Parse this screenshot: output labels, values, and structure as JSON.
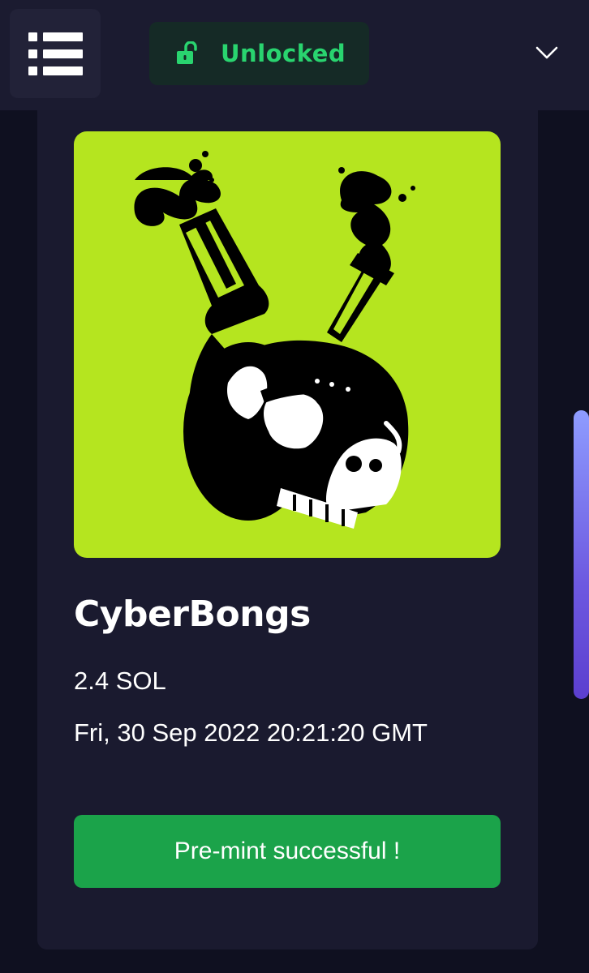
{
  "header": {
    "menu_icon": "list-icon",
    "unlock_label": "Unlocked",
    "unlock_icon": "unlocked-padlock-icon",
    "dropdown_icon": "chevron-down-icon"
  },
  "nft": {
    "name": "CyberBongs",
    "price": "2.4 SOL",
    "date": "Fri, 30 Sep 2022 20:21:20 GMT",
    "image_subject": "skull-bong-illustration",
    "status_label": "Pre-mint successful !"
  },
  "colors": {
    "page_bg": "#0f1020",
    "topbar_bg": "#1b1b30",
    "card_bg": "#1a1a2f",
    "accent_green": "#29d46f",
    "button_green": "#1ba34a",
    "art_bg": "#b5e51f",
    "scroll_thumb": "#7b6cf0"
  }
}
